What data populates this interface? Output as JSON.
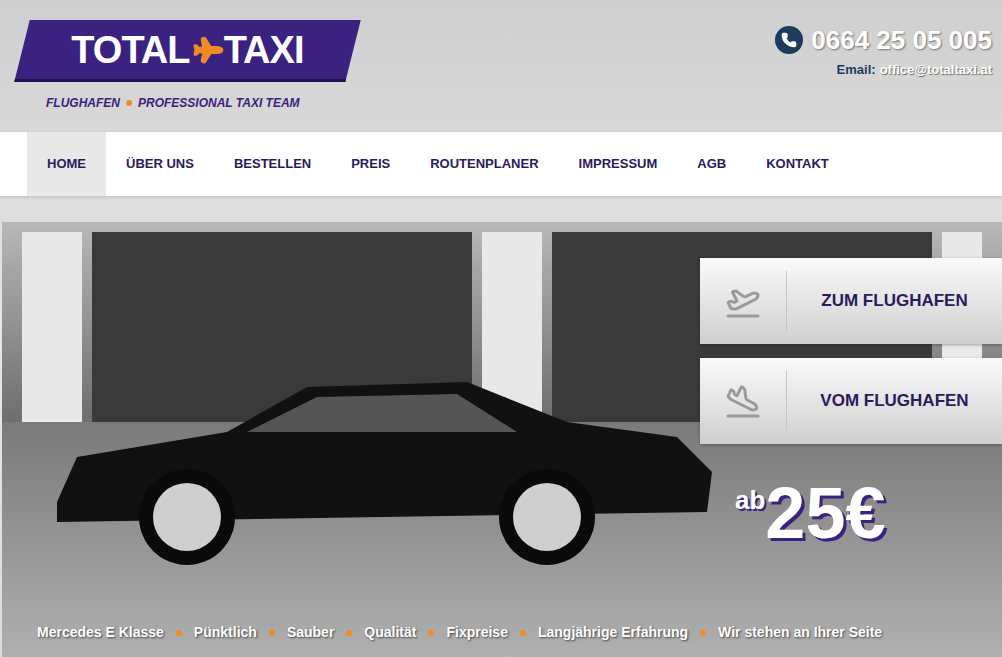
{
  "logo": {
    "left": "TOTAL",
    "right": "TAXI",
    "tagline": [
      "FLUGHAFEN",
      "PROFESSIONAL TAXI TEAM"
    ]
  },
  "contact": {
    "phone": "0664 25 05 005",
    "email_label": "Email:",
    "email": "office@totaltaxi.at"
  },
  "nav": [
    {
      "label": "HOME",
      "selected": true
    },
    {
      "label": "ÜBER UNS",
      "selected": false
    },
    {
      "label": "BESTELLEN",
      "selected": false
    },
    {
      "label": "PREIS",
      "selected": false
    },
    {
      "label": "ROUTENPLANER",
      "selected": false
    },
    {
      "label": "IMPRESSUM",
      "selected": false
    },
    {
      "label": "AGB",
      "selected": false
    },
    {
      "label": "KONTAKT",
      "selected": false
    }
  ],
  "hero": {
    "buttons": [
      {
        "label": "ZUM FLUGHAFEN",
        "kind": "takeoff"
      },
      {
        "label": "VOM FLUGHAFEN",
        "kind": "landing"
      }
    ],
    "price_prefix": "ab",
    "price": "25€"
  },
  "features": [
    "Mercedes E Klasse",
    "Pünktlich",
    "Sauber",
    "Qualität",
    "Fixpreise",
    "Langjährige Erfahrung",
    "Wir stehen an Ihrer Seite"
  ]
}
